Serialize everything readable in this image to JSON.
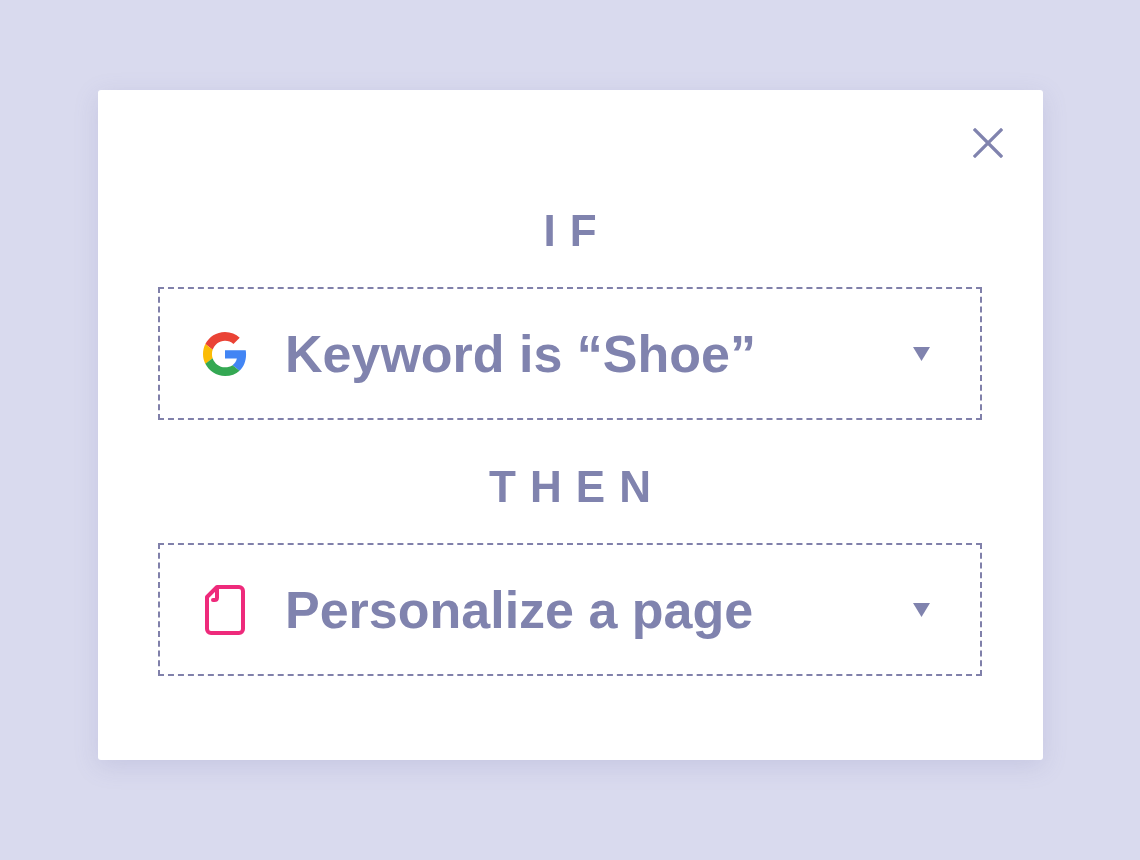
{
  "dialog": {
    "sections": [
      {
        "heading": "IF",
        "select": {
          "kind": "google",
          "value": "Keyword is “Shoe”"
        }
      },
      {
        "heading": "THEN",
        "select": {
          "kind": "page",
          "value": "Personalize a page"
        }
      }
    ]
  }
}
